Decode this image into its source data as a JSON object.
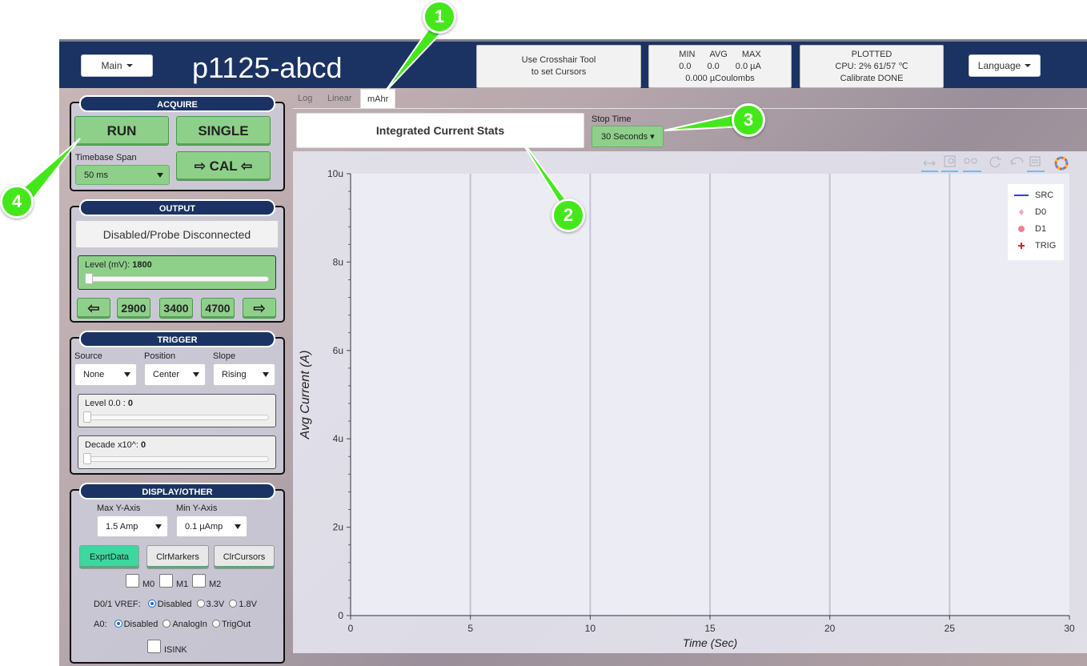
{
  "header": {
    "main_menu": "Main",
    "title": "p1125-abcd",
    "crosshair_line1": "Use Crosshair Tool",
    "crosshair_line2": "to set Cursors",
    "stats": {
      "min_label": "MIN",
      "avg_label": "AVG",
      "max_label": "MAX",
      "min": "0.0",
      "avg": "0.0",
      "max": "0.0 µA",
      "charge": "0.000 µCoulombs"
    },
    "status_line1": "PLOTTED",
    "status_line2": "CPU:  2% 61/57 ℃",
    "status_line3": "Calibrate DONE",
    "language_menu": "Language"
  },
  "acquire": {
    "title": "ACQUIRE",
    "run": "RUN",
    "single": "SINGLE",
    "timebase_label": "Timebase Span",
    "timebase_value": "50 ms",
    "cal": "⇨ CAL ⇦"
  },
  "output": {
    "title": "OUTPUT",
    "status": "Disabled/Probe Disconnected",
    "level_label": "Level (mV): ",
    "level_value": "1800",
    "level_fraction": 0.0,
    "left_arrow": "⇦",
    "preset1": "2900",
    "preset2": "3400",
    "preset3": "4700",
    "right_arrow": "⇨"
  },
  "trigger": {
    "title": "TRIGGER",
    "source_label": "Source",
    "source_value": "None",
    "position_label": "Position",
    "position_value": "Center",
    "slope_label": "Slope",
    "slope_value": "Rising",
    "level_label": "Level 0.0 : ",
    "level_value": "0",
    "decade_label": "Decade x10^: ",
    "decade_value": "0"
  },
  "display": {
    "title": "DISPLAY/OTHER",
    "max_y_label": "Max Y-Axis",
    "max_y_value": "1.5 Amp",
    "min_y_label": "Min Y-Axis",
    "min_y_value": "0.1 µAmp",
    "export": "ExprtData",
    "clr_markers": "ClrMarkers",
    "clr_cursors": "ClrCursors",
    "m0": "M0",
    "m1": "M1",
    "m2": "M2",
    "vref_label": "D0/1 VREF:",
    "vref_opt1": "Disabled",
    "vref_opt2": "3.3V",
    "vref_opt3": "1.8V",
    "a0_label": "A0:",
    "a0_opt1": "Disabled",
    "a0_opt2": "AnalogIn",
    "a0_opt3": "TrigOut",
    "isink": "ISINK"
  },
  "tabs": [
    "Log",
    "Linear",
    "mAhr"
  ],
  "active_tab": "mAhr",
  "stats_button": "Integrated Current Stats",
  "stop_time": {
    "label": "Stop Time",
    "value": "30 Seconds ▾"
  },
  "annotations": [
    "1",
    "2",
    "3",
    "4"
  ],
  "colors": {
    "navy": "#1b3362",
    "green_btn": "#8ed08a",
    "teal_btn": "#3fd6a0",
    "callout": "#44e81a"
  },
  "chart_data": {
    "type": "line",
    "xlabel": "Time (Sec)",
    "ylabel": "Avg Current (A)",
    "x_ticks": [
      "0",
      "5",
      "10",
      "15",
      "20",
      "25",
      "30"
    ],
    "y_ticks": [
      "0",
      "2u",
      "4u",
      "6u",
      "8u",
      "10u"
    ],
    "xlim": [
      0,
      30
    ],
    "ylim": [
      0,
      1e-05
    ],
    "grid": "vertical",
    "legend_position": "top-right",
    "series": [
      {
        "name": "SRC",
        "color": "#3b3be0",
        "values": []
      },
      {
        "name": "D0",
        "color": "#f3a8b8",
        "values": []
      },
      {
        "name": "D1",
        "color": "#f0828f",
        "values": []
      },
      {
        "name": "TRIG",
        "color": "#e0202a",
        "values": []
      }
    ]
  }
}
